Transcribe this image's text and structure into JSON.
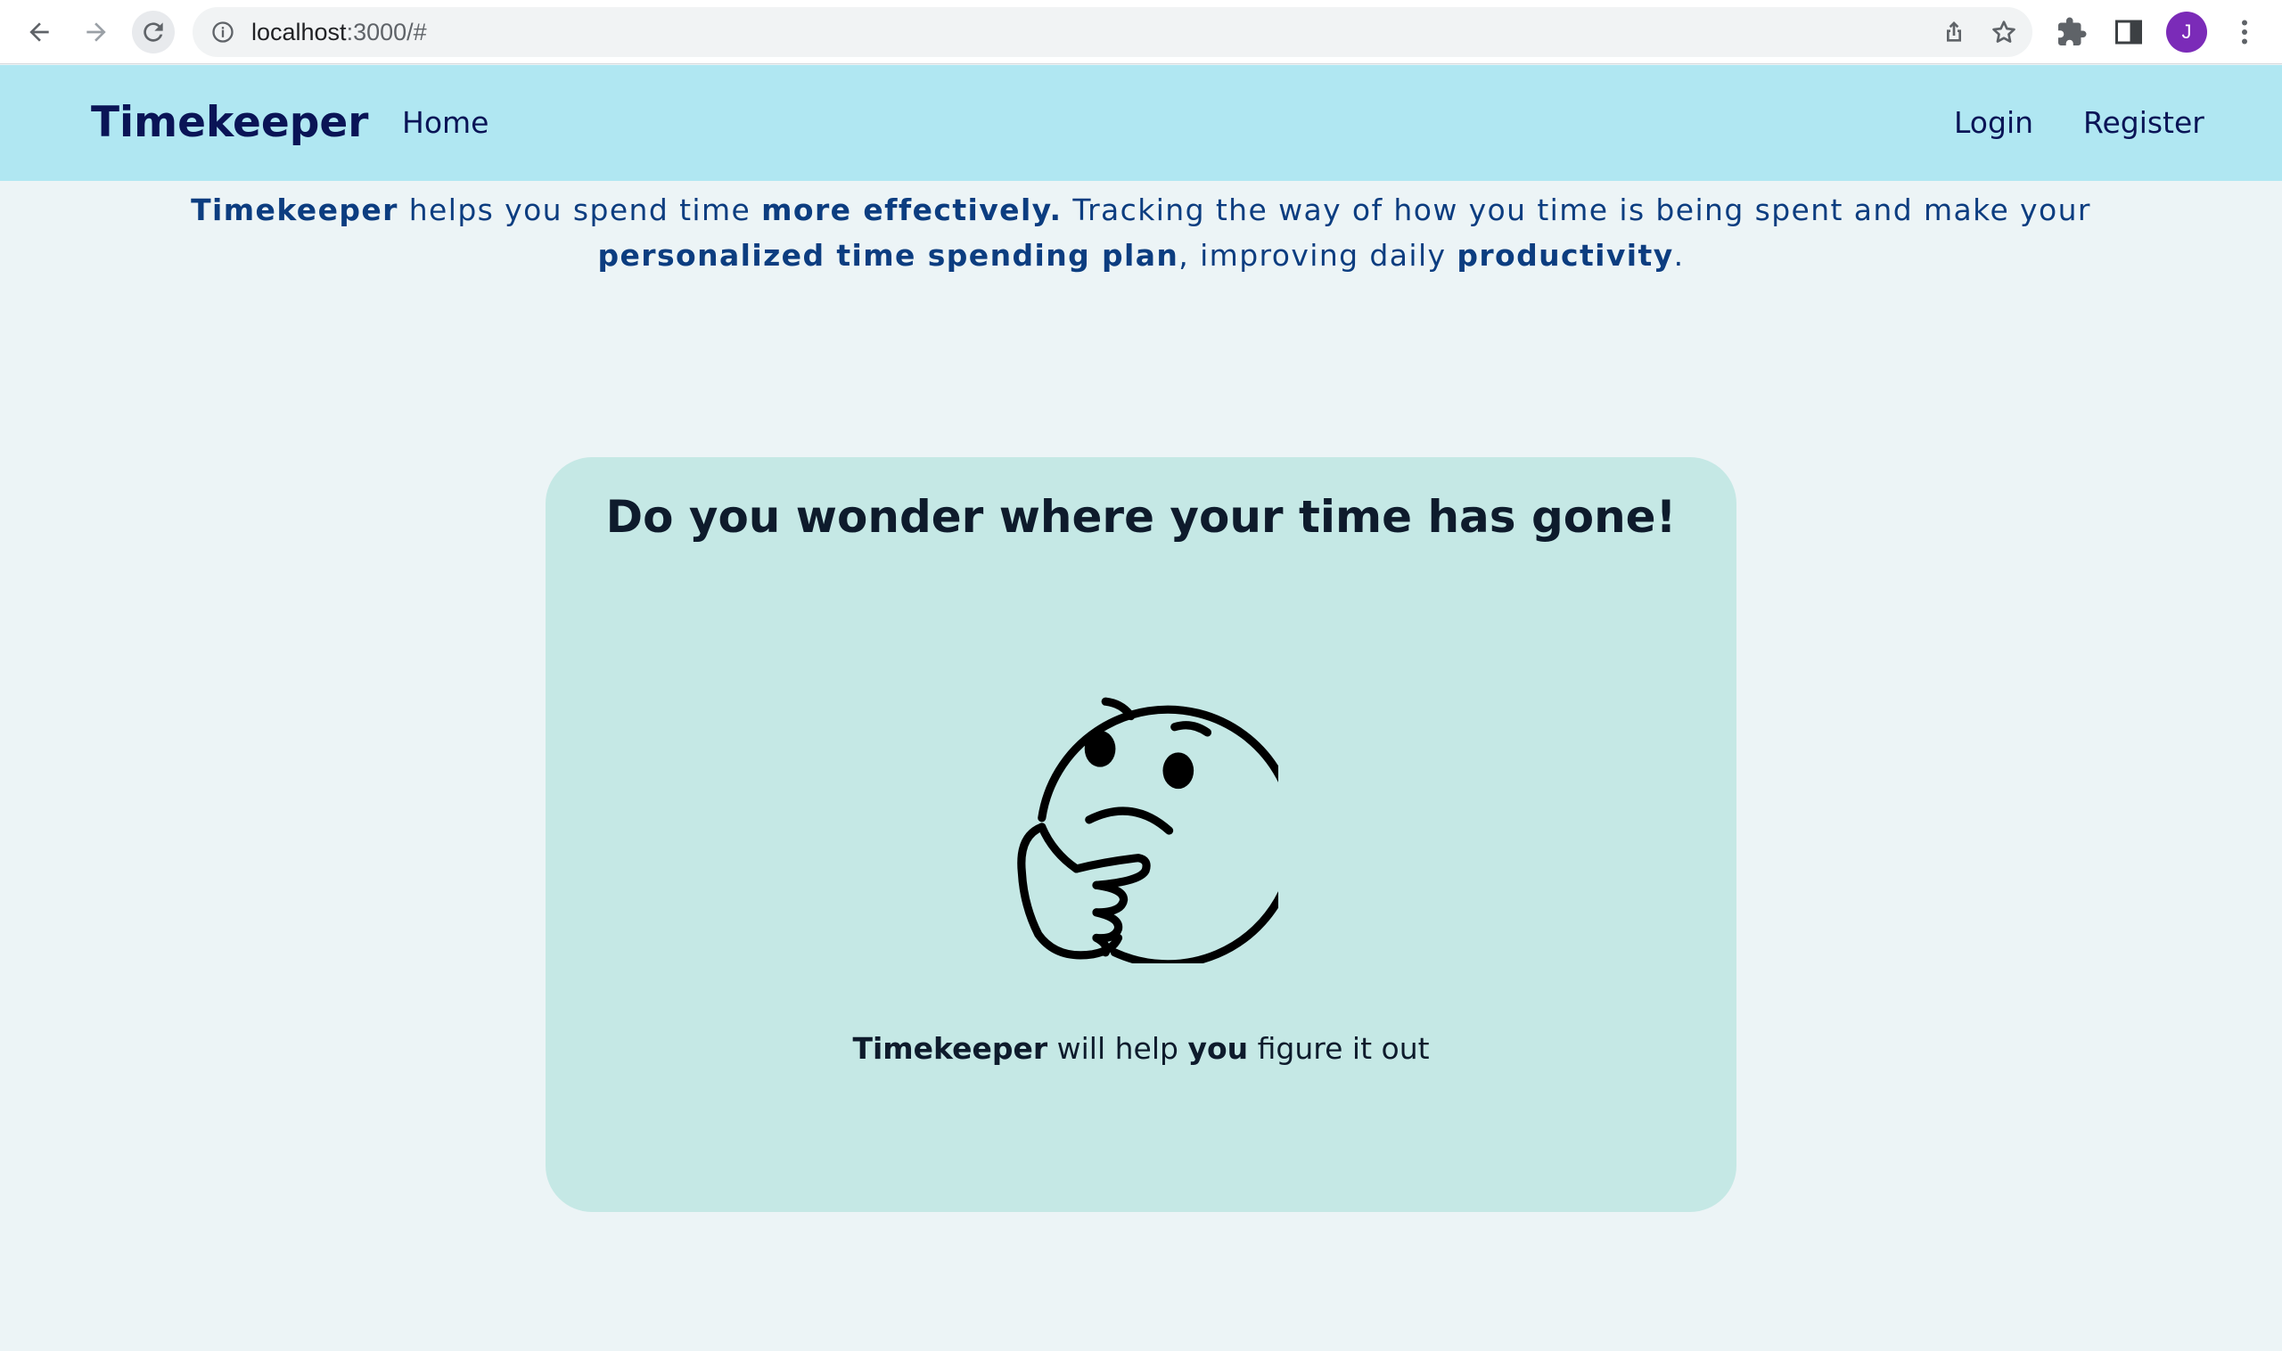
{
  "browser": {
    "url_host": "localhost",
    "url_path": ":3000/#",
    "avatar_initial": "J",
    "icons": [
      "back-icon",
      "forward-icon",
      "reload-icon",
      "info-icon",
      "share-icon",
      "star-icon",
      "extensions-icon",
      "side-panel-icon",
      "menu-icon"
    ]
  },
  "navbar": {
    "brand": "Timekeeper",
    "home": "Home",
    "login": "Login",
    "register": "Register",
    "background": "#b0e7f2"
  },
  "intro": {
    "brand": "Timekeeper",
    "part1": " helps you spend time ",
    "emph1": "more effectively.",
    "part2": " Tracking the way of how you time is being spent and make your ",
    "emph2": "personalized time spending plan",
    "part3": ", improving daily ",
    "emph3": "productivity",
    "part4": "."
  },
  "card": {
    "title": "Do you wonder where your time has gone!",
    "emoji": "thinking-face-icon",
    "sub_brand": "Timekeeper",
    "sub_part1": " will help ",
    "sub_emph": "you",
    "sub_part2": " figure it out",
    "background": "#c5e8e5"
  }
}
